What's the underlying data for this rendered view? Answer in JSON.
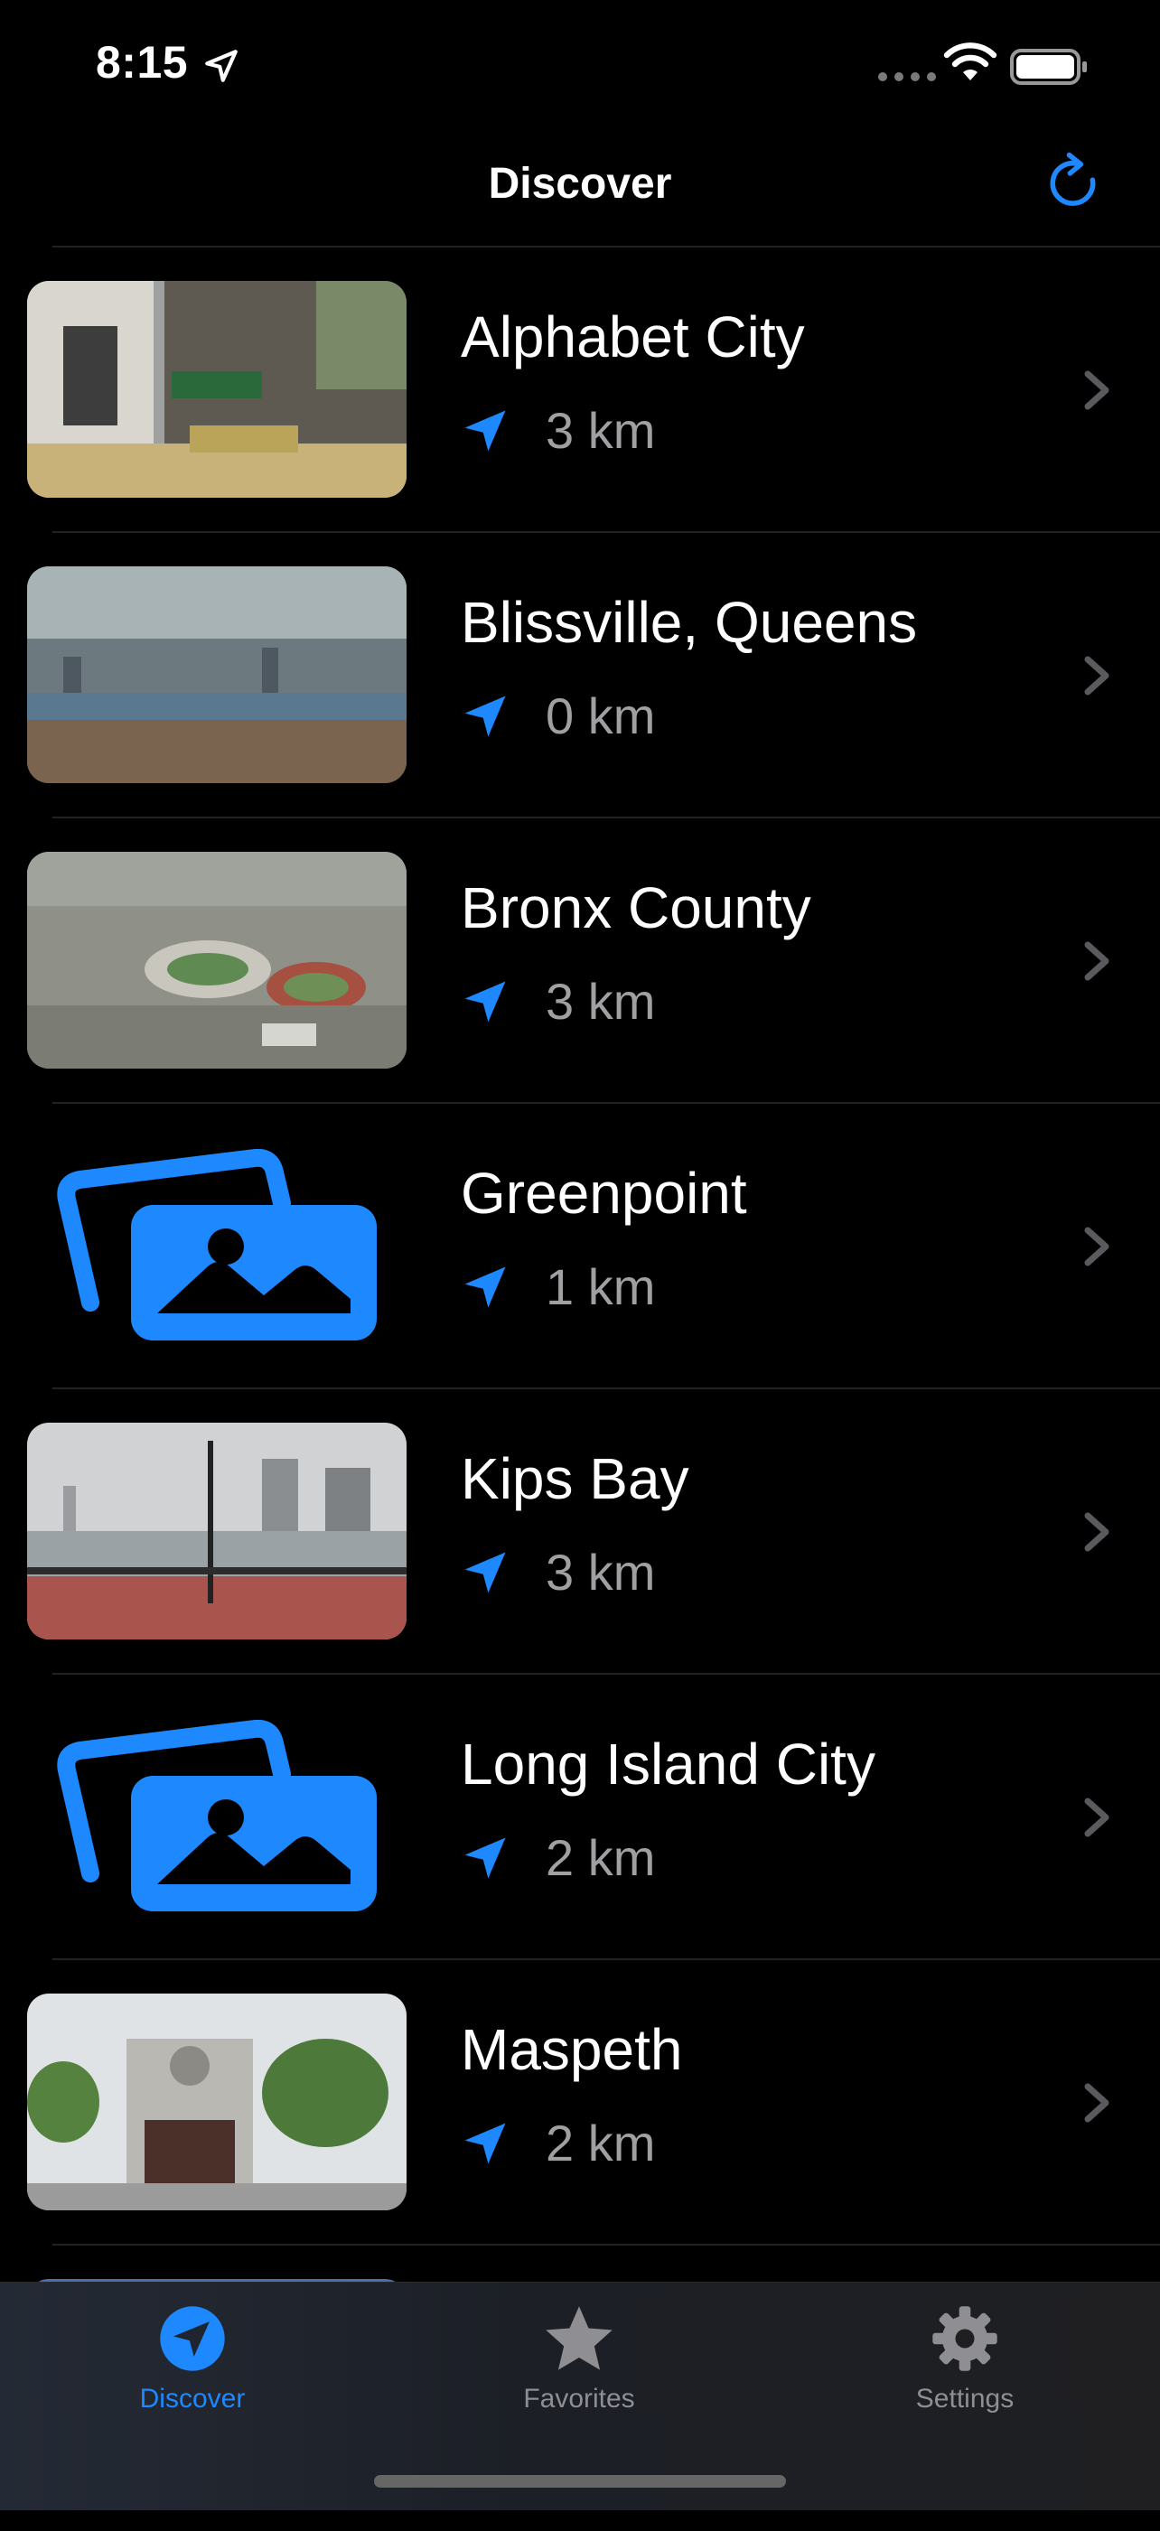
{
  "status_bar": {
    "time": "8:15"
  },
  "nav": {
    "title": "Discover"
  },
  "items": [
    {
      "name": "Alphabet City",
      "distance": "3 km",
      "thumbnail": "photo"
    },
    {
      "name": "Blissville, Queens",
      "distance": "0 km",
      "thumbnail": "photo"
    },
    {
      "name": "Bronx County",
      "distance": "3 km",
      "thumbnail": "photo"
    },
    {
      "name": "Greenpoint",
      "distance": "1 km",
      "thumbnail": "placeholder"
    },
    {
      "name": "Kips Bay",
      "distance": "3 km",
      "thumbnail": "photo"
    },
    {
      "name": "Long Island City",
      "distance": "2 km",
      "thumbnail": "placeholder"
    },
    {
      "name": "Maspeth",
      "distance": "2 km",
      "thumbnail": "photo"
    }
  ],
  "tabs": [
    {
      "label": "Discover",
      "icon": "location-arrow-icon",
      "selected": true
    },
    {
      "label": "Favorites",
      "icon": "star-icon",
      "selected": false
    },
    {
      "label": "Settings",
      "icon": "gear-icon",
      "selected": false
    }
  ],
  "colors": {
    "accent": "#1e88ff",
    "secondary_text": "#a0a0a3",
    "background": "#000000"
  }
}
